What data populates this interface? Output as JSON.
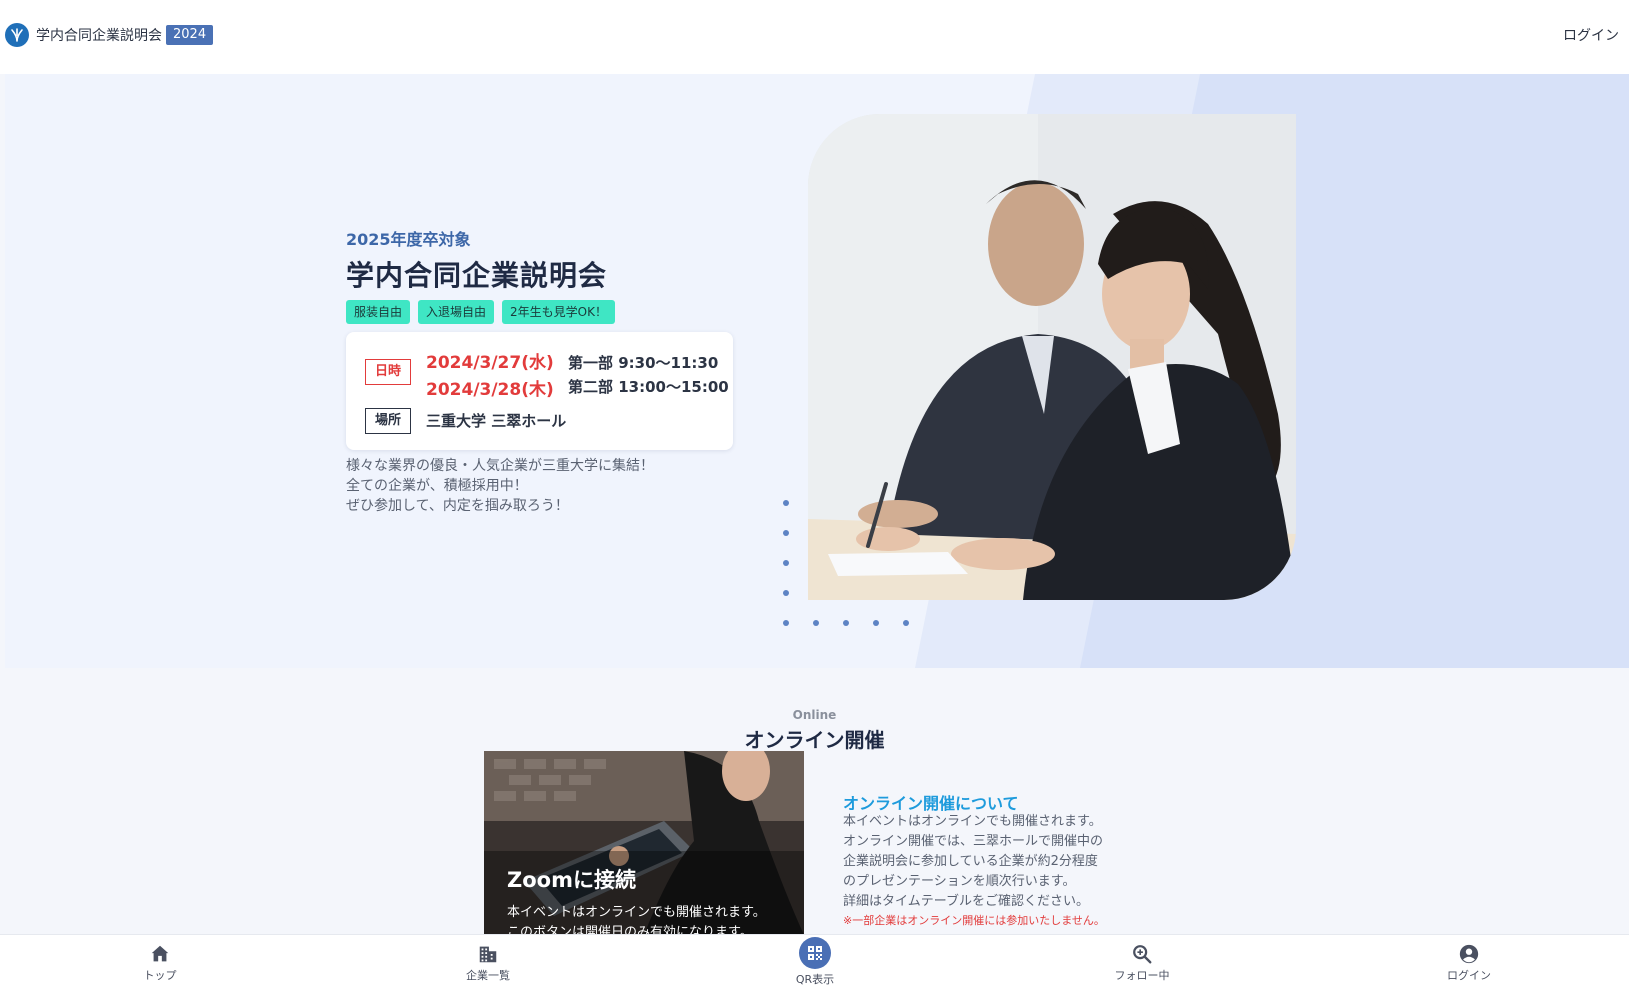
{
  "header": {
    "app_title": "学内合同企業説明会",
    "year_badge": "2024",
    "login": "ログイン"
  },
  "hero": {
    "subtitle": "2025年度卒対象",
    "title": "学内合同企業説明会",
    "tags": [
      "服装自由",
      "入退場自由",
      "2年生も見学OK！"
    ],
    "date_label": "日時",
    "dates": [
      "2024/3/27(水)",
      "2024/3/28(木)"
    ],
    "sessions": [
      "第一部 9:30〜11:30",
      "第二部 13:00〜15:00"
    ],
    "place_label": "場所",
    "place": "三重大学 三翠ホール",
    "description": [
      "様々な業界の優良・人気企業が三重大学に集結！",
      "全ての企業が、積極採用中！",
      "ぜひ参加して、内定を掴み取ろう！"
    ]
  },
  "online": {
    "kicker": "Online",
    "title": "オンライン開催",
    "zoom_card": {
      "title": "Zoomに接続",
      "desc_line1": "本イベントはオンラインでも開催されます。",
      "desc_line2": "このボタンは開催日のみ有効になります。"
    },
    "about_title": "オンライン開催について",
    "about_lines": [
      "本イベントはオンラインでも開催されます。",
      "オンライン開催では、三翠ホールで開催中の",
      "企業説明会に参加している企業が約2分程度",
      "のプレゼンテーションを順次行います。",
      "詳細はタイムテーブルをご確認ください。"
    ],
    "about_note": "※一部企業はオンライン開催には参加いたしません。"
  },
  "bottom_nav": {
    "items": [
      {
        "label": "トップ",
        "icon": "home-icon"
      },
      {
        "label": "企業一覧",
        "icon": "building-icon"
      },
      {
        "label": "QR表示",
        "icon": "qr-code-icon"
      },
      {
        "label": "フォロー中",
        "icon": "search-zoom-icon"
      },
      {
        "label": "ログイン",
        "icon": "account-circle-icon"
      }
    ]
  },
  "colors": {
    "accent": "#4a71b5",
    "tag_bg": "#3fe6c4",
    "date_red": "#e23b3b",
    "link_blue": "#1e9bdc"
  }
}
